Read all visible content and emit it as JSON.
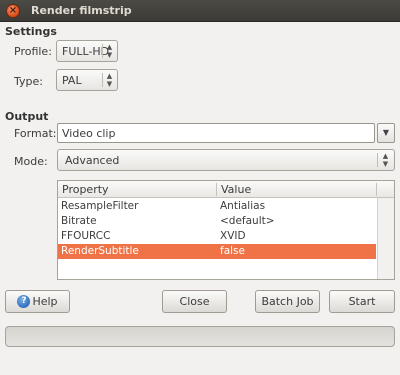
{
  "window": {
    "title": "Render filmstrip"
  },
  "settings": {
    "section_label": "Settings",
    "profile_label": "Profile:",
    "profile_value": "FULL-HD",
    "type_label": "Type:",
    "type_value": "PAL"
  },
  "output": {
    "section_label": "Output",
    "format_label": "Format:",
    "format_value": "Video clip",
    "mode_label": "Mode:",
    "mode_value": "Advanced"
  },
  "table": {
    "headers": [
      "Property",
      "Value"
    ],
    "rows": [
      {
        "property": "ResampleFilter",
        "value": "Antialias",
        "selected": false
      },
      {
        "property": "Bitrate",
        "value": "<default>",
        "selected": false
      },
      {
        "property": "FFOURCC",
        "value": "XVID",
        "selected": false
      },
      {
        "property": "RenderSubtitle",
        "value": "false",
        "selected": true
      }
    ]
  },
  "buttons": {
    "help": "Help",
    "close": "Close",
    "batch_job": "Batch Job",
    "start": "Start"
  },
  "progress": {
    "value": 0
  },
  "colors": {
    "selection": "#ef7346",
    "titlebar": "#3c3b37",
    "close": "#e0531d"
  },
  "icons": {
    "close": "close-icon",
    "help": "help-icon"
  }
}
